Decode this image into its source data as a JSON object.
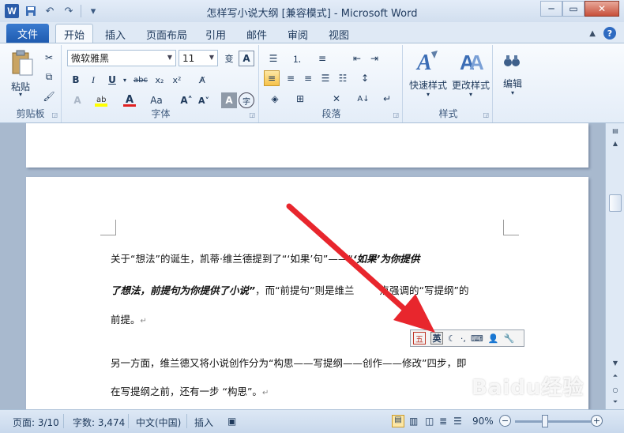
{
  "window": {
    "title": "怎样写小说大纲 [兼容模式] - Microsoft Word",
    "app_icon_letter": "W"
  },
  "tabs": {
    "file": "文件",
    "items": [
      "开始",
      "插入",
      "页面布局",
      "引用",
      "邮件",
      "审阅",
      "视图"
    ],
    "active": "开始"
  },
  "ribbon": {
    "clipboard": {
      "label": "剪贴板",
      "paste": "粘贴"
    },
    "font": {
      "label": "字体",
      "family": "微软雅黑",
      "size": "11"
    },
    "paragraph": {
      "label": "段落"
    },
    "styles": {
      "label": "样式",
      "quick_styles": "快速样式",
      "change_styles": "更改样式"
    },
    "editing": {
      "label": "编辑"
    }
  },
  "document": {
    "p1_line1_a": "关于“想法”的诞生，凯蒂·维兰德提到了“‘如果’",
    "p1_line1_b": "句”——“",
    "p1_line1_c": "‘如果’为你提供",
    "p1_line2_a": "了想法，前提句为你提供了小说”",
    "p1_line2_b": "，而“前提句”则是维兰",
    "p1_line2_c": "点强调的“写提纲”的",
    "p1_line3": "前提。",
    "p2_line1": "另一方面，维兰德又将小说创作分为“构思——写提纲——创作——修改”四步，即",
    "p2_line2": "在写提纲之前，还有一步  “构思”。"
  },
  "ime": {
    "mode_label": "英"
  },
  "status_bar": {
    "page": "页面: 3/10",
    "words": "字数: 3,474",
    "language": "中文(中国)",
    "insert": "插入",
    "zoom": "90%"
  },
  "watermark": {
    "text": "Baidu经验",
    "sub": "jingyan.baidu.com"
  },
  "colors": {
    "accent": "#2a5caa",
    "arrow": "#e8262d",
    "highlight": "#f6c24b"
  }
}
